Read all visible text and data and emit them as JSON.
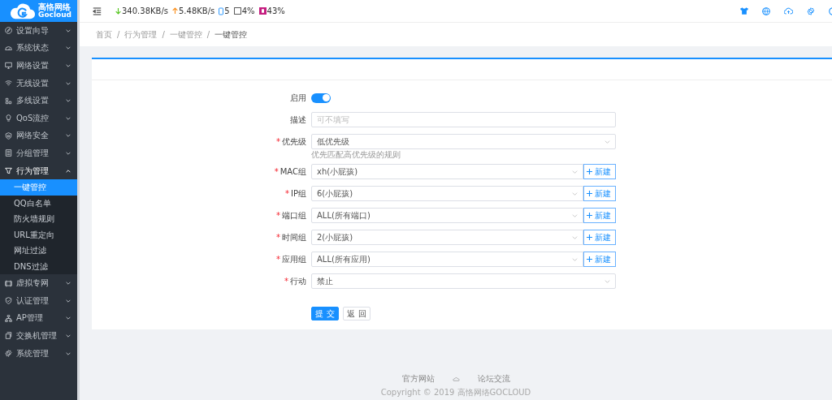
{
  "logo": {
    "name": "高恪网络",
    "sub": "Gocloud"
  },
  "status": {
    "down": "340.38KB/s",
    "up": "5.48KB/s",
    "devices": "5",
    "cpu": "4%",
    "memory": "43%"
  },
  "sidebar": {
    "items": [
      {
        "label": "设置向导",
        "expanded": false
      },
      {
        "label": "系统状态",
        "expanded": false
      },
      {
        "label": "网络设置",
        "expanded": false
      },
      {
        "label": "无线设置",
        "expanded": false
      },
      {
        "label": "多线设置",
        "expanded": false
      },
      {
        "label": "QoS流控",
        "expanded": false
      },
      {
        "label": "网络安全",
        "expanded": false
      },
      {
        "label": "分组管理",
        "expanded": false
      },
      {
        "label": "行为管理",
        "expanded": true,
        "children": [
          {
            "label": "一键管控",
            "selected": true
          },
          {
            "label": "QQ白名单",
            "selected": false
          },
          {
            "label": "防火墙规则",
            "selected": false
          },
          {
            "label": "URL重定向",
            "selected": false
          },
          {
            "label": "网址过滤",
            "selected": false
          },
          {
            "label": "DNS过滤",
            "selected": false
          }
        ]
      },
      {
        "label": "虚拟专网",
        "expanded": false
      },
      {
        "label": "认证管理",
        "expanded": false
      },
      {
        "label": "AP管理",
        "expanded": false
      },
      {
        "label": "交换机管理",
        "expanded": false
      },
      {
        "label": "系统管理",
        "expanded": false
      }
    ]
  },
  "breadcrumb": {
    "separator": "/",
    "items": [
      "首页",
      "行为管理",
      "一键管控",
      "一键管控"
    ]
  },
  "form": {
    "enable": {
      "label": "启用",
      "on": true
    },
    "fields": [
      {
        "kind": "text",
        "label": "描述",
        "placeholder": "可不填写"
      },
      {
        "kind": "select",
        "required_mark": "*",
        "label": "优先级",
        "value": "低优先级",
        "hint": "优先匹配高优先级的规则"
      },
      {
        "kind": "select_new",
        "required_mark": "*",
        "label": "MAC组",
        "value": "xh(小屁孩)",
        "button": "新建"
      },
      {
        "kind": "select_new",
        "required_mark": "*",
        "label": "IP组",
        "value": "6(小屁孩)",
        "button": "新建"
      },
      {
        "kind": "select_new",
        "required_mark": "*",
        "label": "端口组",
        "value": "ALL(所有端口)",
        "button": "新建"
      },
      {
        "kind": "select_new",
        "required_mark": "*",
        "label": "时间组",
        "value": "2(小屁孩)",
        "button": "新建"
      },
      {
        "kind": "select_new",
        "required_mark": "*",
        "label": "应用组",
        "value": "ALL(所有应用)",
        "button": "新建"
      },
      {
        "kind": "select",
        "required_mark": "*",
        "label": "行动",
        "value": "禁止"
      }
    ],
    "submit": "提 交",
    "back": "返 回"
  },
  "footer": {
    "links": [
      "官方网站",
      "论坛交流"
    ],
    "copyright": "Copyright © 2019 高恪网络GOCLOUD"
  }
}
